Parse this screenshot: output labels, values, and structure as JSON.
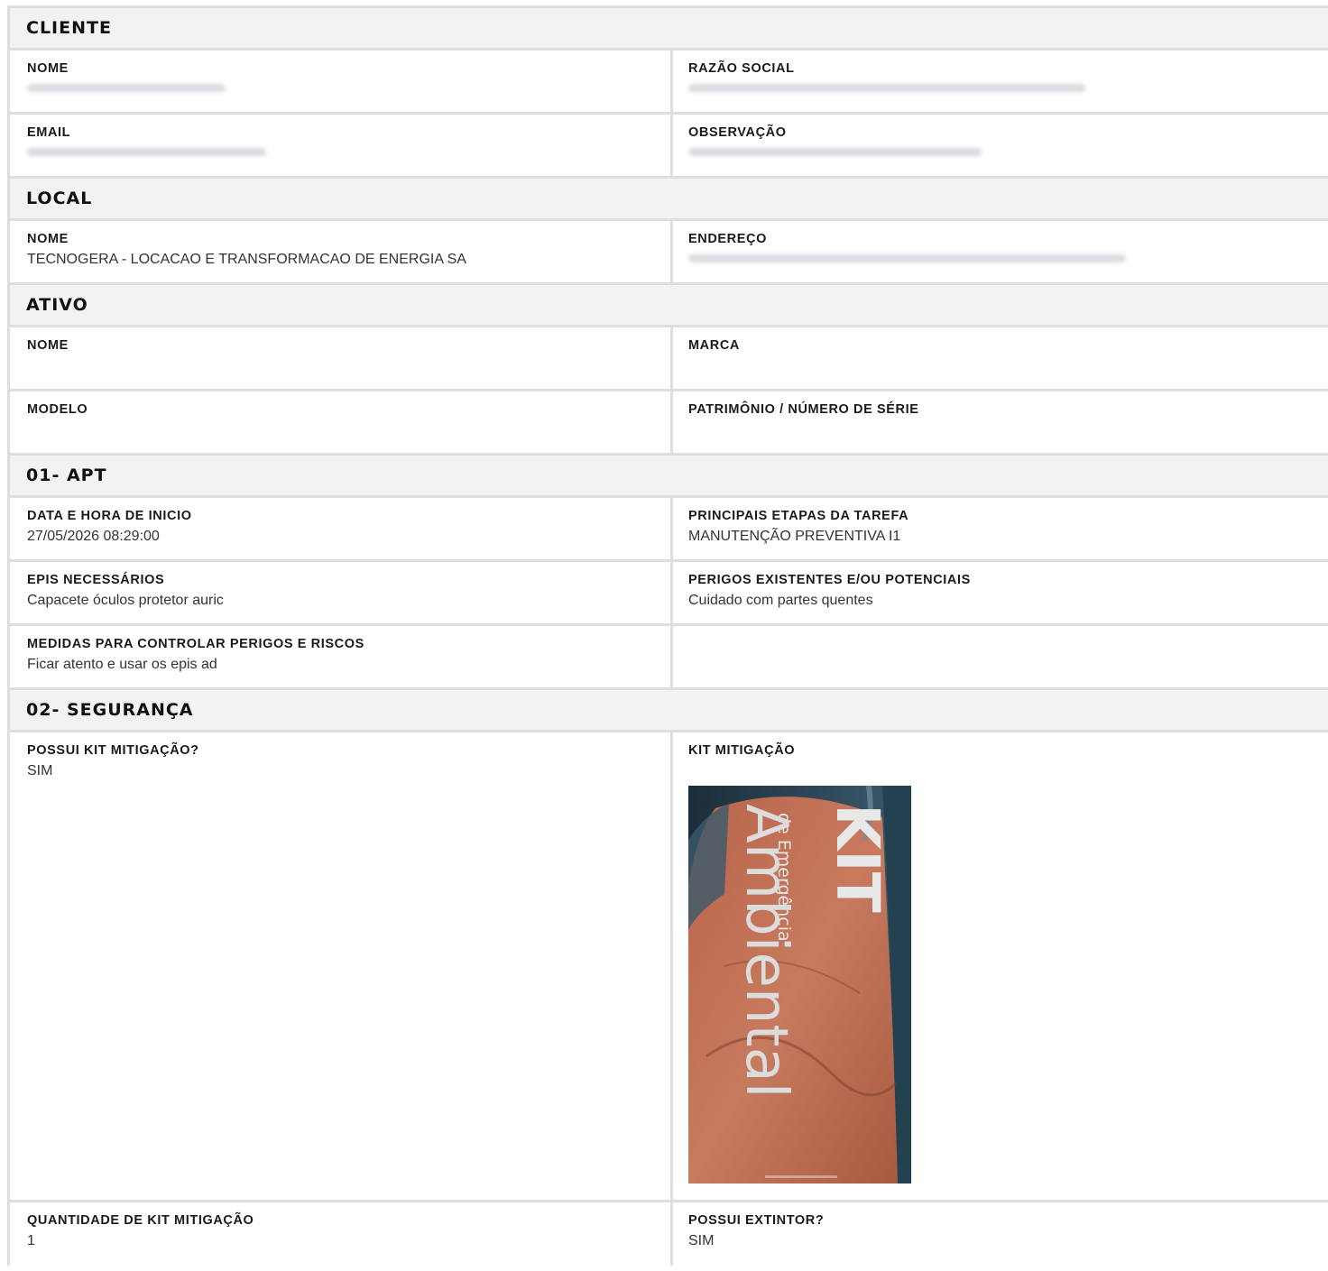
{
  "sections": {
    "cliente": {
      "title": "CLIENTE",
      "nome_label": "NOME",
      "razao_label": "RAZÃO SOCIAL",
      "email_label": "EMAIL",
      "observacao_label": "OBSERVAÇÃO"
    },
    "local": {
      "title": "LOCAL",
      "nome_label": "NOME",
      "nome_value": "TECNOGERA - LOCACAO E TRANSFORMACAO DE ENERGIA SA",
      "endereco_label": "ENDEREÇO"
    },
    "ativo": {
      "title": "ATIVO",
      "nome_label": "NOME",
      "marca_label": "MARCA",
      "modelo_label": "MODELO",
      "patrimonio_label": "PATRIMÔNIO / NÚMERO DE SÉRIE"
    },
    "apt": {
      "title": "01- APT",
      "data_label": "DATA E HORA DE INICIO",
      "data_value": "27/05/2026 08:29:00",
      "etapas_label": "PRINCIPAIS ETAPAS DA TAREFA",
      "etapas_value": "MANUTENÇÃO PREVENTIVA I1",
      "epis_label": "EPIS NECESSÁRIOS",
      "epis_value": "Capacete óculos protetor auric",
      "perigos_label": "PERIGOS EXISTENTES E/OU POTENCIAIS",
      "perigos_value": "Cuidado com partes quentes",
      "medidas_label": "MEDIDAS PARA CONTROLAR PERIGOS E RISCOS",
      "medidas_value": "Ficar atento e usar os epis ad"
    },
    "seguranca": {
      "title": "02- SEGURANÇA",
      "possui_kit_label": "POSSUI KIT MITIGAÇÃO?",
      "possui_kit_value": "SIM",
      "kit_label": "KIT MITIGAÇÃO",
      "photo_text_kit": "KIT",
      "photo_text_emergencia": "de Emergência",
      "photo_text_ambiental": "Ambiental",
      "quantidade_label": "QUANTIDADE DE KIT MITIGAÇÃO",
      "quantidade_value": "1",
      "extintor_label": "POSSUI EXTINTOR?",
      "extintor_value": "SIM"
    }
  }
}
